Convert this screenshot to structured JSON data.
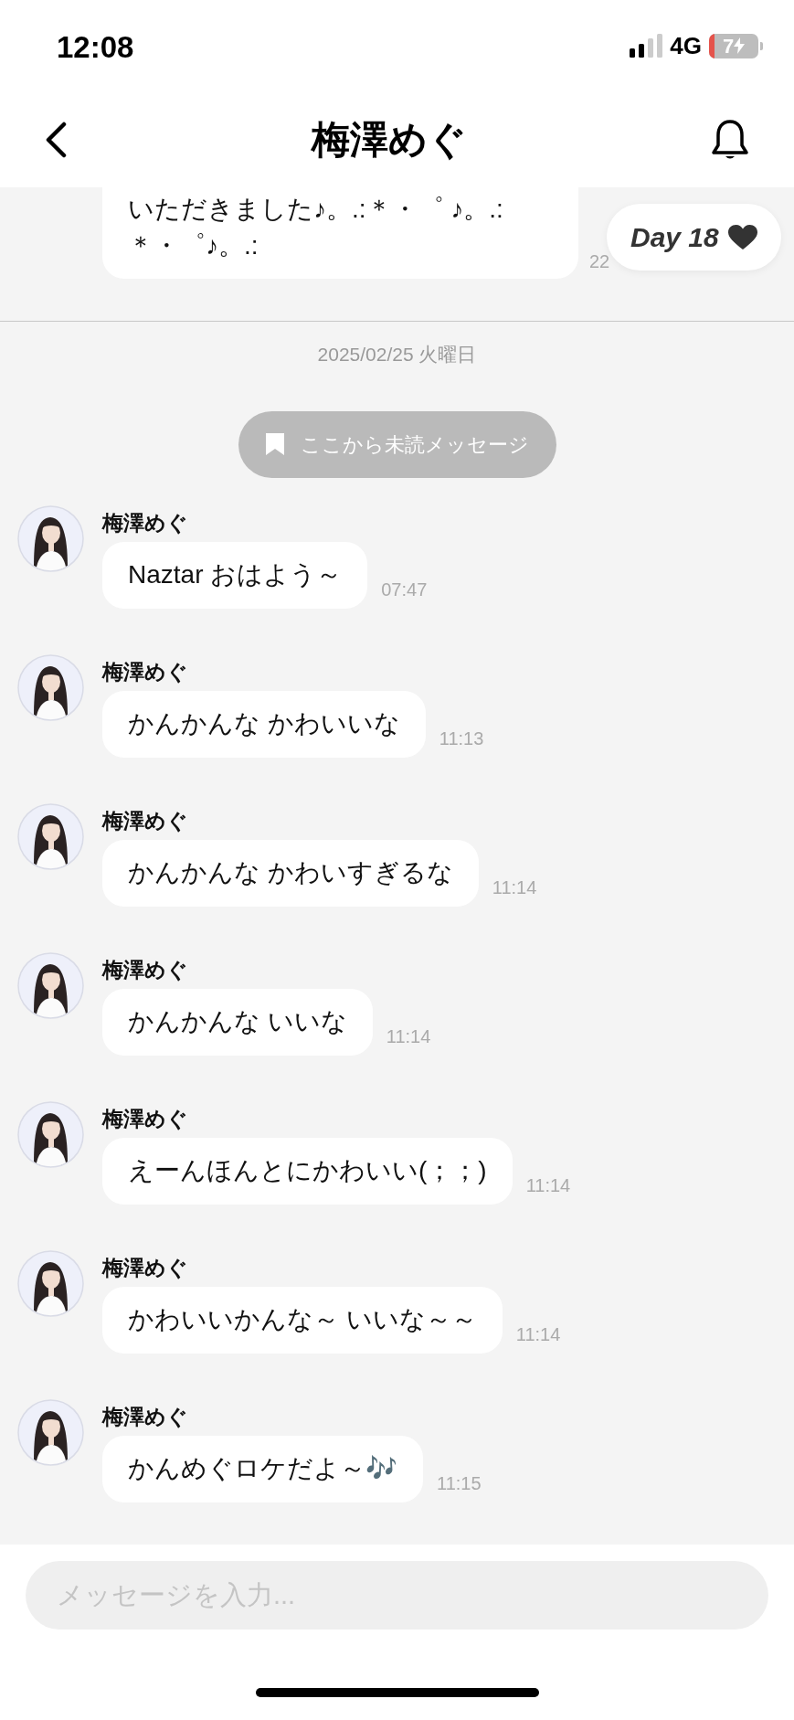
{
  "status_bar": {
    "time": "12:08",
    "network": "4G",
    "battery": "7"
  },
  "header": {
    "title": "梅澤めぐ"
  },
  "previous_message": {
    "text": "いただきました♪。.:＊・゜ ♪。.:＊・゜♪。.:",
    "time": "22"
  },
  "day_badge": {
    "label": "Day 18"
  },
  "date_divider": "2025/02/25 火曜日",
  "unread_marker": "ここから未読メッセージ",
  "messages": [
    {
      "sender": "梅澤めぐ",
      "text": "Naztar おはよう～",
      "time": "07:47"
    },
    {
      "sender": "梅澤めぐ",
      "text": "かんかんな かわいいな",
      "time": "11:13"
    },
    {
      "sender": "梅澤めぐ",
      "text": "かんかんな かわいすぎるな",
      "time": "11:14"
    },
    {
      "sender": "梅澤めぐ",
      "text": "かんかんな いいな",
      "time": "11:14"
    },
    {
      "sender": "梅澤めぐ",
      "text": "えーんほんとにかわいい(；；)",
      "time": "11:14"
    },
    {
      "sender": "梅澤めぐ",
      "text": "かわいいかんな～ いいな～～",
      "time": "11:14"
    },
    {
      "sender": "梅澤めぐ",
      "text": "かんめぐロケだよ～🎶",
      "time": "11:15"
    }
  ],
  "composer": {
    "placeholder": "メッセージを入力..."
  }
}
